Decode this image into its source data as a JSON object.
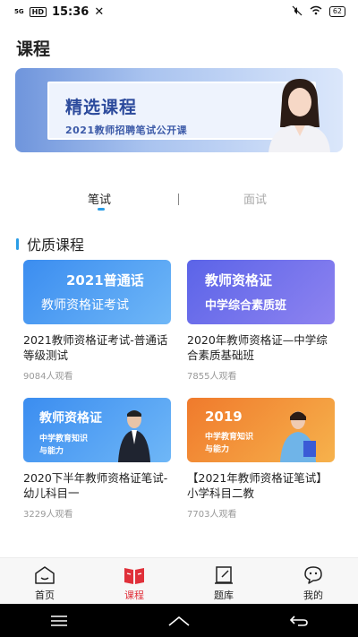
{
  "status_bar": {
    "signal": "5G",
    "hd": "HD",
    "time": "15:36",
    "battery": "62"
  },
  "page_title": "课程",
  "banner": {
    "title": "精选课程",
    "subtitle": "2021教师招聘笔试公开课"
  },
  "tabs": [
    {
      "label": "笔试",
      "active": true
    },
    {
      "label": "面试",
      "active": false
    }
  ],
  "section_title": "优质课程",
  "courses": [
    {
      "thumb_line1": "2021普通话",
      "thumb_line2": "教师资格证考试",
      "title": "2021教师资格证考试-普通话等级测试",
      "views": "9084人观看"
    },
    {
      "thumb_line1": "教师资格证",
      "thumb_line2": "中学综合素质班",
      "title": "2020年教师资格证—中学综合素质基础班",
      "views": "7855人观看"
    },
    {
      "thumb_line1": "教师资格证",
      "thumb_line2": "中学教育知识",
      "thumb_line3": "与能力",
      "title": "2020下半年教师资格证笔试-幼儿科目一",
      "views": "3229人观看"
    },
    {
      "thumb_line1": "2019",
      "thumb_line2": "中学教育知识",
      "thumb_line3": "与能力",
      "title": "【2021年教师资格证笔试】小学科目二教",
      "views": "7703人观看"
    }
  ],
  "bottom_nav": [
    {
      "label": "首页",
      "icon": "home-icon",
      "active": false
    },
    {
      "label": "课程",
      "icon": "book-icon",
      "active": true
    },
    {
      "label": "题库",
      "icon": "exam-icon",
      "active": false
    },
    {
      "label": "我的",
      "icon": "profile-icon",
      "active": false
    }
  ],
  "colors": {
    "accent": "#2a9de6",
    "active_nav": "#e0303a"
  }
}
